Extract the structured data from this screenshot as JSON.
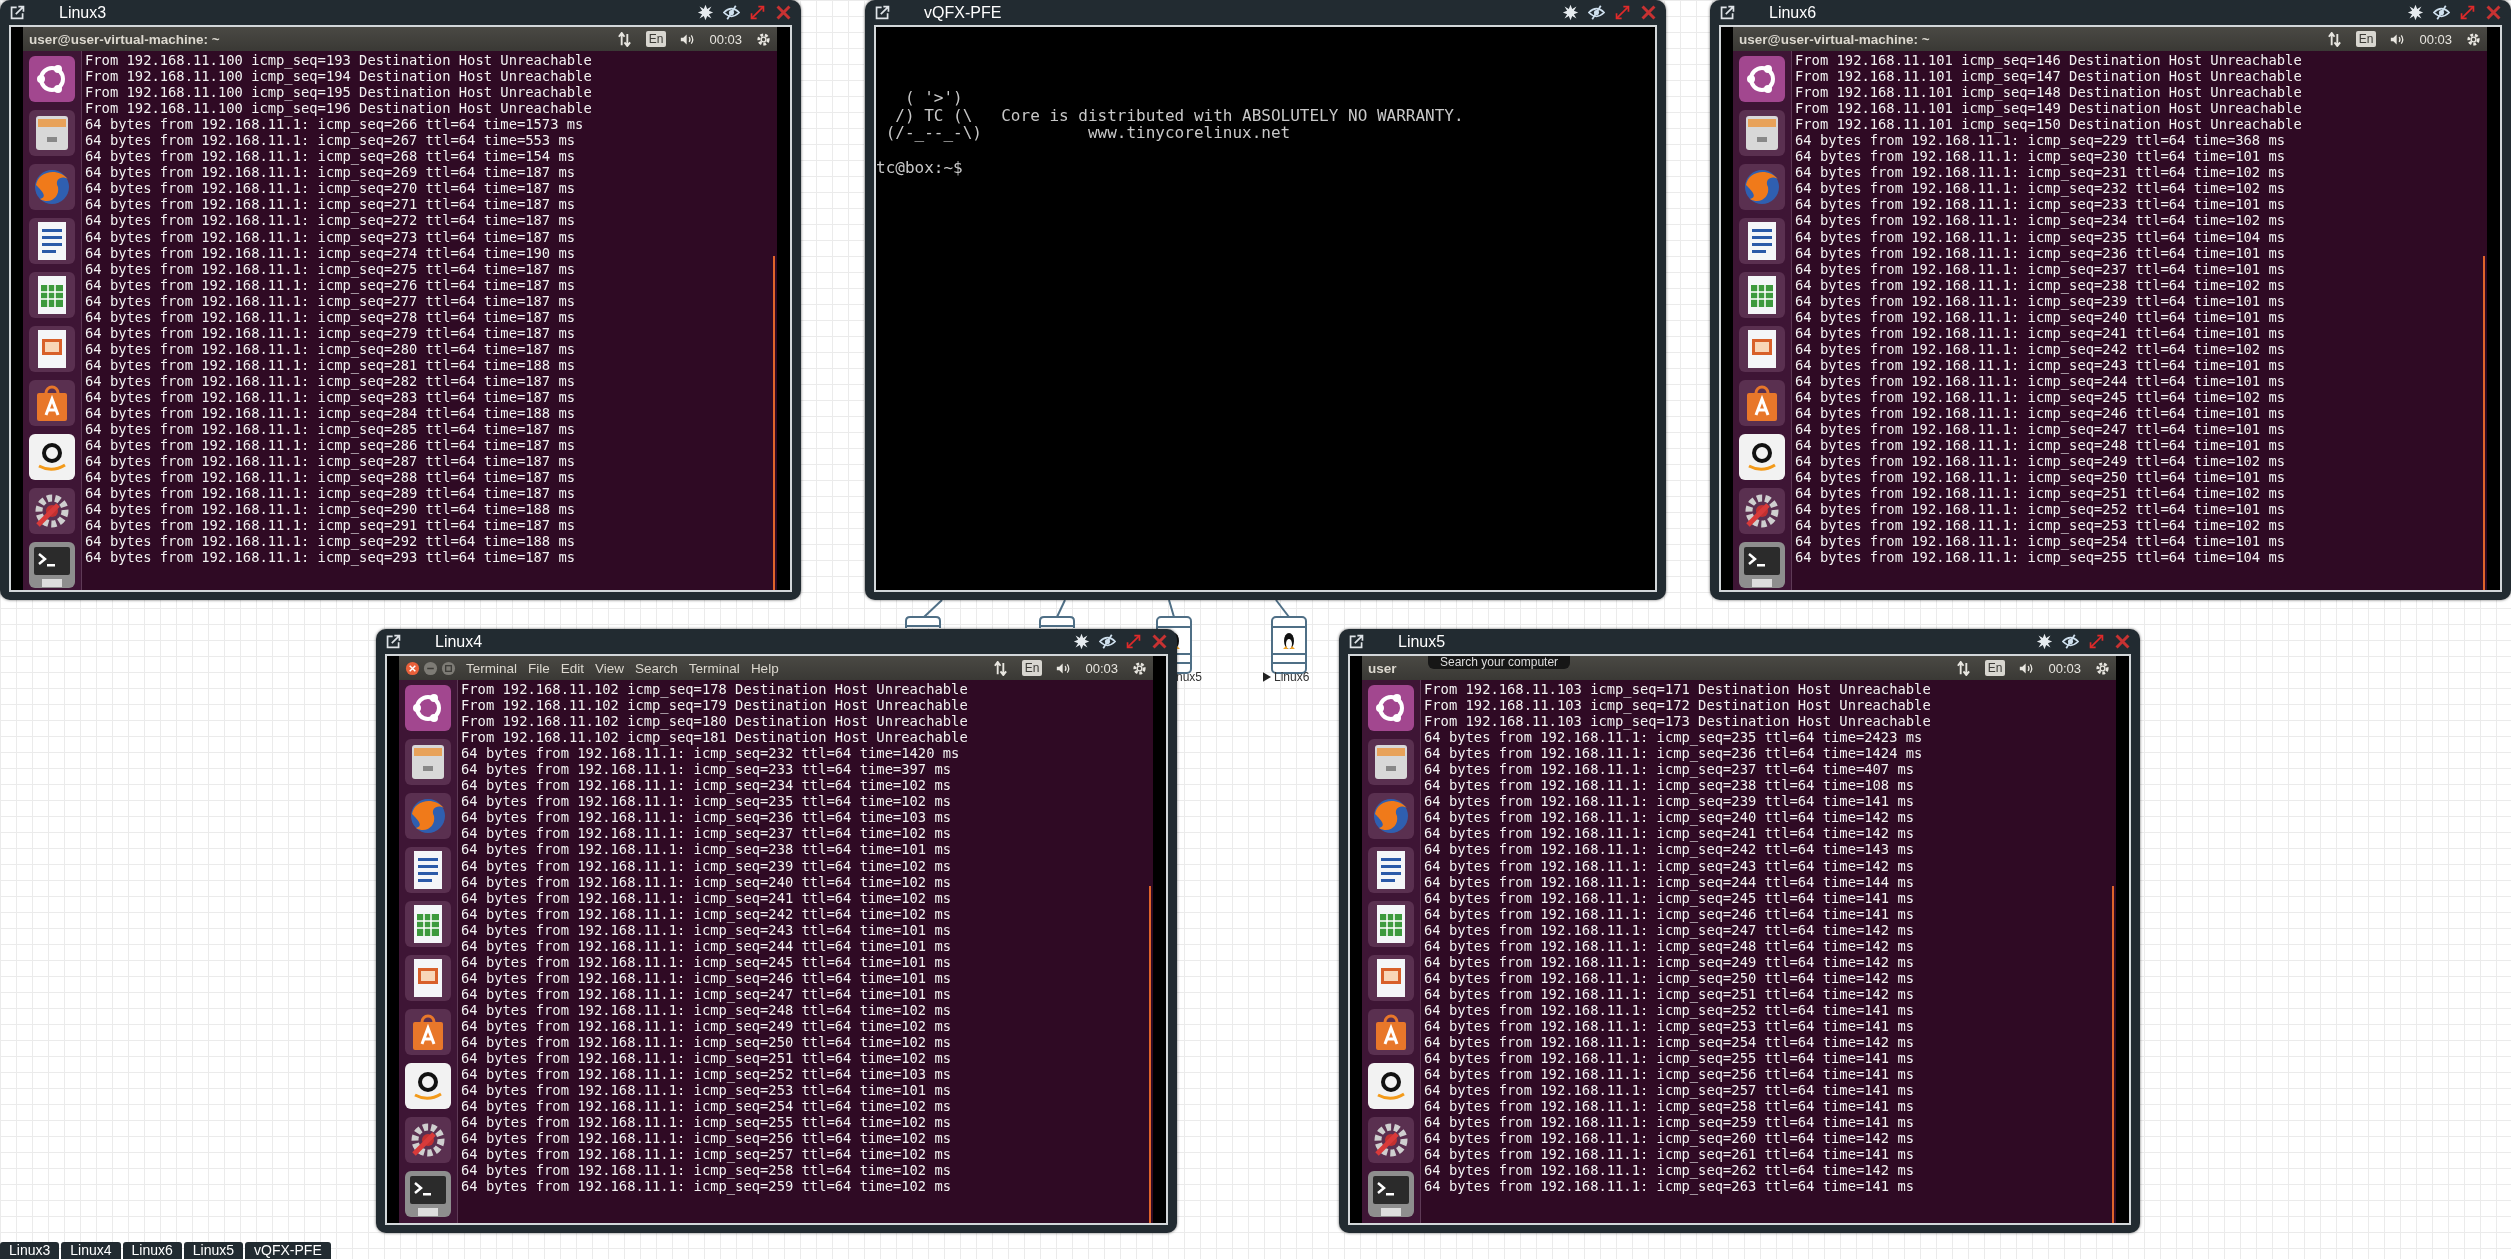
{
  "windows": [
    {
      "kind": "terminal",
      "title": "Linux3",
      "panel": {
        "kind": "title",
        "title": "user@user-virtual-machine: ~"
      },
      "keyboard": "En",
      "clock": "00:03",
      "lines": [
        "From 192.168.11.100 icmp_seq=193 Destination Host Unreachable",
        "From 192.168.11.100 icmp_seq=194 Destination Host Unreachable",
        "From 192.168.11.100 icmp_seq=195 Destination Host Unreachable",
        "From 192.168.11.100 icmp_seq=196 Destination Host Unreachable",
        "64 bytes from 192.168.11.1: icmp_seq=266 ttl=64 time=1573 ms",
        "64 bytes from 192.168.11.1: icmp_seq=267 ttl=64 time=553 ms",
        "64 bytes from 192.168.11.1: icmp_seq=268 ttl=64 time=154 ms",
        "64 bytes from 192.168.11.1: icmp_seq=269 ttl=64 time=187 ms",
        "64 bytes from 192.168.11.1: icmp_seq=270 ttl=64 time=187 ms",
        "64 bytes from 192.168.11.1: icmp_seq=271 ttl=64 time=187 ms",
        "64 bytes from 192.168.11.1: icmp_seq=272 ttl=64 time=187 ms",
        "64 bytes from 192.168.11.1: icmp_seq=273 ttl=64 time=187 ms",
        "64 bytes from 192.168.11.1: icmp_seq=274 ttl=64 time=190 ms",
        "64 bytes from 192.168.11.1: icmp_seq=275 ttl=64 time=187 ms",
        "64 bytes from 192.168.11.1: icmp_seq=276 ttl=64 time=187 ms",
        "64 bytes from 192.168.11.1: icmp_seq=277 ttl=64 time=187 ms",
        "64 bytes from 192.168.11.1: icmp_seq=278 ttl=64 time=187 ms",
        "64 bytes from 192.168.11.1: icmp_seq=279 ttl=64 time=187 ms",
        "64 bytes from 192.168.11.1: icmp_seq=280 ttl=64 time=187 ms",
        "64 bytes from 192.168.11.1: icmp_seq=281 ttl=64 time=188 ms",
        "64 bytes from 192.168.11.1: icmp_seq=282 ttl=64 time=187 ms",
        "64 bytes from 192.168.11.1: icmp_seq=283 ttl=64 time=187 ms",
        "64 bytes from 192.168.11.1: icmp_seq=284 ttl=64 time=188 ms",
        "64 bytes from 192.168.11.1: icmp_seq=285 ttl=64 time=187 ms",
        "64 bytes from 192.168.11.1: icmp_seq=286 ttl=64 time=187 ms",
        "64 bytes from 192.168.11.1: icmp_seq=287 ttl=64 time=187 ms",
        "64 bytes from 192.168.11.1: icmp_seq=288 ttl=64 time=187 ms",
        "64 bytes from 192.168.11.1: icmp_seq=289 ttl=64 time=187 ms",
        "64 bytes from 192.168.11.1: icmp_seq=290 ttl=64 time=188 ms",
        "64 bytes from 192.168.11.1: icmp_seq=291 ttl=64 time=187 ms",
        "64 bytes from 192.168.11.1: icmp_seq=292 ttl=64 time=188 ms",
        "64 bytes from 192.168.11.1: icmp_seq=293 ttl=64 time=187 ms"
      ]
    },
    {
      "kind": "console",
      "title": "vQFX-PFE",
      "banner": [
        "   ( '>')",
        "  /) TC (\\   Core is distributed with ABSOLUTELY NO WARRANTY.",
        " (/-_--_-\\)           www.tinycorelinux.net"
      ],
      "prompt": "tc@box:~$"
    },
    {
      "kind": "terminal",
      "title": "Linux6",
      "panel": {
        "kind": "title",
        "title": "user@user-virtual-machine: ~"
      },
      "keyboard": "En",
      "clock": "00:03",
      "lines": [
        "From 192.168.11.101 icmp_seq=146 Destination Host Unreachable",
        "From 192.168.11.101 icmp_seq=147 Destination Host Unreachable",
        "From 192.168.11.101 icmp_seq=148 Destination Host Unreachable",
        "From 192.168.11.101 icmp_seq=149 Destination Host Unreachable",
        "From 192.168.11.101 icmp_seq=150 Destination Host Unreachable",
        "64 bytes from 192.168.11.1: icmp_seq=229 ttl=64 time=368 ms",
        "64 bytes from 192.168.11.1: icmp_seq=230 ttl=64 time=101 ms",
        "64 bytes from 192.168.11.1: icmp_seq=231 ttl=64 time=102 ms",
        "64 bytes from 192.168.11.1: icmp_seq=232 ttl=64 time=102 ms",
        "64 bytes from 192.168.11.1: icmp_seq=233 ttl=64 time=101 ms",
        "64 bytes from 192.168.11.1: icmp_seq=234 ttl=64 time=102 ms",
        "64 bytes from 192.168.11.1: icmp_seq=235 ttl=64 time=104 ms",
        "64 bytes from 192.168.11.1: icmp_seq=236 ttl=64 time=101 ms",
        "64 bytes from 192.168.11.1: icmp_seq=237 ttl=64 time=101 ms",
        "64 bytes from 192.168.11.1: icmp_seq=238 ttl=64 time=102 ms",
        "64 bytes from 192.168.11.1: icmp_seq=239 ttl=64 time=101 ms",
        "64 bytes from 192.168.11.1: icmp_seq=240 ttl=64 time=101 ms",
        "64 bytes from 192.168.11.1: icmp_seq=241 ttl=64 time=101 ms",
        "64 bytes from 192.168.11.1: icmp_seq=242 ttl=64 time=102 ms",
        "64 bytes from 192.168.11.1: icmp_seq=243 ttl=64 time=101 ms",
        "64 bytes from 192.168.11.1: icmp_seq=244 ttl=64 time=101 ms",
        "64 bytes from 192.168.11.1: icmp_seq=245 ttl=64 time=102 ms",
        "64 bytes from 192.168.11.1: icmp_seq=246 ttl=64 time=101 ms",
        "64 bytes from 192.168.11.1: icmp_seq=247 ttl=64 time=101 ms",
        "64 bytes from 192.168.11.1: icmp_seq=248 ttl=64 time=101 ms",
        "64 bytes from 192.168.11.1: icmp_seq=249 ttl=64 time=102 ms",
        "64 bytes from 192.168.11.1: icmp_seq=250 ttl=64 time=101 ms",
        "64 bytes from 192.168.11.1: icmp_seq=251 ttl=64 time=102 ms",
        "64 bytes from 192.168.11.1: icmp_seq=252 ttl=64 time=101 ms",
        "64 bytes from 192.168.11.1: icmp_seq=253 ttl=64 time=102 ms",
        "64 bytes from 192.168.11.1: icmp_seq=254 ttl=64 time=101 ms",
        "64 bytes from 192.168.11.1: icmp_seq=255 ttl=64 time=104 ms"
      ]
    },
    {
      "kind": "terminal",
      "title": "Linux4",
      "panel": {
        "kind": "menu",
        "menu": [
          "Terminal",
          "File",
          "Edit",
          "View",
          "Search",
          "Terminal",
          "Help"
        ]
      },
      "keyboard": "En",
      "clock": "00:03",
      "lines": [
        "From 192.168.11.102 icmp_seq=178 Destination Host Unreachable",
        "From 192.168.11.102 icmp_seq=179 Destination Host Unreachable",
        "From 192.168.11.102 icmp_seq=180 Destination Host Unreachable",
        "From 192.168.11.102 icmp_seq=181 Destination Host Unreachable",
        "64 bytes from 192.168.11.1: icmp_seq=232 ttl=64 time=1420 ms",
        "64 bytes from 192.168.11.1: icmp_seq=233 ttl=64 time=397 ms",
        "64 bytes from 192.168.11.1: icmp_seq=234 ttl=64 time=102 ms",
        "64 bytes from 192.168.11.1: icmp_seq=235 ttl=64 time=102 ms",
        "64 bytes from 192.168.11.1: icmp_seq=236 ttl=64 time=103 ms",
        "64 bytes from 192.168.11.1: icmp_seq=237 ttl=64 time=102 ms",
        "64 bytes from 192.168.11.1: icmp_seq=238 ttl=64 time=101 ms",
        "64 bytes from 192.168.11.1: icmp_seq=239 ttl=64 time=102 ms",
        "64 bytes from 192.168.11.1: icmp_seq=240 ttl=64 time=102 ms",
        "64 bytes from 192.168.11.1: icmp_seq=241 ttl=64 time=102 ms",
        "64 bytes from 192.168.11.1: icmp_seq=242 ttl=64 time=102 ms",
        "64 bytes from 192.168.11.1: icmp_seq=243 ttl=64 time=101 ms",
        "64 bytes from 192.168.11.1: icmp_seq=244 ttl=64 time=101 ms",
        "64 bytes from 192.168.11.1: icmp_seq=245 ttl=64 time=101 ms",
        "64 bytes from 192.168.11.1: icmp_seq=246 ttl=64 time=101 ms",
        "64 bytes from 192.168.11.1: icmp_seq=247 ttl=64 time=101 ms",
        "64 bytes from 192.168.11.1: icmp_seq=248 ttl=64 time=102 ms",
        "64 bytes from 192.168.11.1: icmp_seq=249 ttl=64 time=102 ms",
        "64 bytes from 192.168.11.1: icmp_seq=250 ttl=64 time=102 ms",
        "64 bytes from 192.168.11.1: icmp_seq=251 ttl=64 time=102 ms",
        "64 bytes from 192.168.11.1: icmp_seq=252 ttl=64 time=103 ms",
        "64 bytes from 192.168.11.1: icmp_seq=253 ttl=64 time=101 ms",
        "64 bytes from 192.168.11.1: icmp_seq=254 ttl=64 time=102 ms",
        "64 bytes from 192.168.11.1: icmp_seq=255 ttl=64 time=102 ms",
        "64 bytes from 192.168.11.1: icmp_seq=256 ttl=64 time=102 ms",
        "64 bytes from 192.168.11.1: icmp_seq=257 ttl=64 time=102 ms",
        "64 bytes from 192.168.11.1: icmp_seq=258 ttl=64 time=102 ms",
        "64 bytes from 192.168.11.1: icmp_seq=259 ttl=64 time=102 ms"
      ]
    },
    {
      "kind": "terminal",
      "title": "Linux5",
      "panel": {
        "kind": "title",
        "title": "user"
      },
      "tooltip": "Search your computer",
      "keyboard": "En",
      "clock": "00:03",
      "lines": [
        "From 192.168.11.103 icmp_seq=171 Destination Host Unreachable",
        "From 192.168.11.103 icmp_seq=172 Destination Host Unreachable",
        "From 192.168.11.103 icmp_seq=173 Destination Host Unreachable",
        "64 bytes from 192.168.11.1: icmp_seq=235 ttl=64 time=2423 ms",
        "64 bytes from 192.168.11.1: icmp_seq=236 ttl=64 time=1424 ms",
        "64 bytes from 192.168.11.1: icmp_seq=237 ttl=64 time=407 ms",
        "64 bytes from 192.168.11.1: icmp_seq=238 ttl=64 time=108 ms",
        "64 bytes from 192.168.11.1: icmp_seq=239 ttl=64 time=141 ms",
        "64 bytes from 192.168.11.1: icmp_seq=240 ttl=64 time=142 ms",
        "64 bytes from 192.168.11.1: icmp_seq=241 ttl=64 time=142 ms",
        "64 bytes from 192.168.11.1: icmp_seq=242 ttl=64 time=143 ms",
        "64 bytes from 192.168.11.1: icmp_seq=243 ttl=64 time=142 ms",
        "64 bytes from 192.168.11.1: icmp_seq=244 ttl=64 time=144 ms",
        "64 bytes from 192.168.11.1: icmp_seq=245 ttl=64 time=141 ms",
        "64 bytes from 192.168.11.1: icmp_seq=246 ttl=64 time=141 ms",
        "64 bytes from 192.168.11.1: icmp_seq=247 ttl=64 time=142 ms",
        "64 bytes from 192.168.11.1: icmp_seq=248 ttl=64 time=142 ms",
        "64 bytes from 192.168.11.1: icmp_seq=249 ttl=64 time=142 ms",
        "64 bytes from 192.168.11.1: icmp_seq=250 ttl=64 time=142 ms",
        "64 bytes from 192.168.11.1: icmp_seq=251 ttl=64 time=142 ms",
        "64 bytes from 192.168.11.1: icmp_seq=252 ttl=64 time=141 ms",
        "64 bytes from 192.168.11.1: icmp_seq=253 ttl=64 time=141 ms",
        "64 bytes from 192.168.11.1: icmp_seq=254 ttl=64 time=142 ms",
        "64 bytes from 192.168.11.1: icmp_seq=255 ttl=64 time=141 ms",
        "64 bytes from 192.168.11.1: icmp_seq=256 ttl=64 time=141 ms",
        "64 bytes from 192.168.11.1: icmp_seq=257 ttl=64 time=141 ms",
        "64 bytes from 192.168.11.1: icmp_seq=258 ttl=64 time=141 ms",
        "64 bytes from 192.168.11.1: icmp_seq=259 ttl=64 time=141 ms",
        "64 bytes from 192.168.11.1: icmp_seq=260 ttl=64 time=142 ms",
        "64 bytes from 192.168.11.1: icmp_seq=261 ttl=64 time=141 ms",
        "64 bytes from 192.168.11.1: icmp_seq=262 ttl=64 time=142 ms",
        "64 bytes from 192.168.11.1: icmp_seq=263 ttl=64 time=141 ms"
      ]
    }
  ],
  "topology": {
    "nodes": [
      {
        "kind": "server",
        "running": false
      },
      {
        "kind": "server",
        "running": false
      },
      {
        "kind": "server",
        "label": "nux5",
        "running": false
      },
      {
        "kind": "server",
        "label": "Linux6",
        "running": true
      }
    ]
  },
  "taskbar": {
    "tabs": [
      "Linux3",
      "Linux4",
      "Linux6",
      "Linux5",
      "vQFX-PFE"
    ]
  }
}
